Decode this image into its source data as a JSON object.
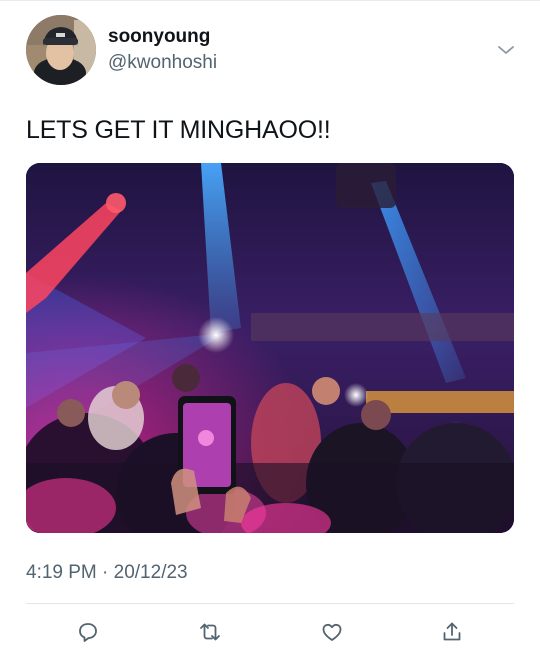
{
  "tweet": {
    "display_name": "soonyoung",
    "handle": "@kwonhoshi",
    "text": "LETS GET IT MINGHAOO!!",
    "timestamp": "4:19 PM · 20/12/23"
  },
  "icons": {
    "menu": "chevron-down-icon",
    "reply": "reply-icon",
    "retweet": "retweet-icon",
    "like": "heart-icon",
    "share": "share-icon"
  },
  "colors": {
    "text": "#0f1419",
    "secondary": "#536471",
    "divider": "#e1e8ed"
  }
}
